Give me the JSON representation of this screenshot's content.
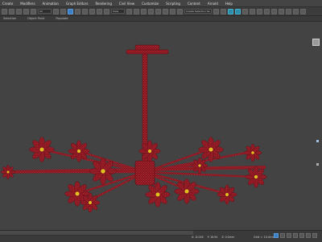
{
  "menu": [
    "Create",
    "Modifiers",
    "Animation",
    "Graph Editors",
    "Rendering",
    "Civil View",
    "Customize",
    "Scripting",
    "Content",
    "Arnold",
    "Help"
  ],
  "toolbar": {
    "filter_value": "All",
    "view_value": "View",
    "selection_set_value": "Create Selection Se"
  },
  "subbar": [
    "Selection",
    "Object Paint",
    "Populate"
  ],
  "status": {
    "left": "",
    "x": "X: -8.016",
    "y": "Y: 16.94",
    "z": "Z: 0.0mm",
    "grid": "Grid = 10.0mm",
    "add_time_tag": "Add Time Tag"
  },
  "colors": {
    "model": "#a8222e",
    "wire": "#5e0c14",
    "flower_center": "#e0c020",
    "background": "#434343"
  }
}
